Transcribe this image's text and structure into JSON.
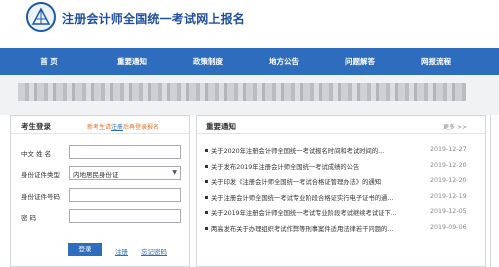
{
  "header": {
    "title": "注册会计师全国统一考试网上报名"
  },
  "nav": {
    "items": [
      "首 页",
      "重要通知",
      "政策制度",
      "地方公告",
      "问题解答",
      "网报流程"
    ]
  },
  "login": {
    "title": "考生登录",
    "hint_prefix": "新考生请",
    "hint_register": "注册",
    "hint_suffix": "后再登录报名",
    "name_label": "中文 姓 名",
    "idtype_label": "身份证件类型",
    "idtype_value": "内地居民身份证",
    "idnum_label": "身份证件号码",
    "password_label": "密       码",
    "login_button": "登录",
    "register_link": "注册",
    "forgot_link": "忘记密码"
  },
  "news": {
    "title": "重要通知",
    "more": "更多 >>",
    "items": [
      {
        "text": "关于2020年注册会计师全国统一考试报名时间和考试时间的...",
        "date": "2019-12-27"
      },
      {
        "text": "关于发布2019年注册会计师全国统一考试成绩的公告",
        "date": "2019-12-20"
      },
      {
        "text": "关于印发《注册会计师全国统一考试合格证管理办法》的通知",
        "date": "2019-12-20"
      },
      {
        "text": "关于注册会计师全国统一考试专业阶段合格证实行电子证书的通...",
        "date": "2019-12-19"
      },
      {
        "text": "关于2019年注册会计师全国统一考试专业阶段考试继续考试证下...",
        "date": "2019-12-05"
      },
      {
        "text": "两高发布关于办理组织考试作弊等刑事案件适用法律若干问题的...",
        "date": "2019-09-06"
      }
    ]
  }
}
